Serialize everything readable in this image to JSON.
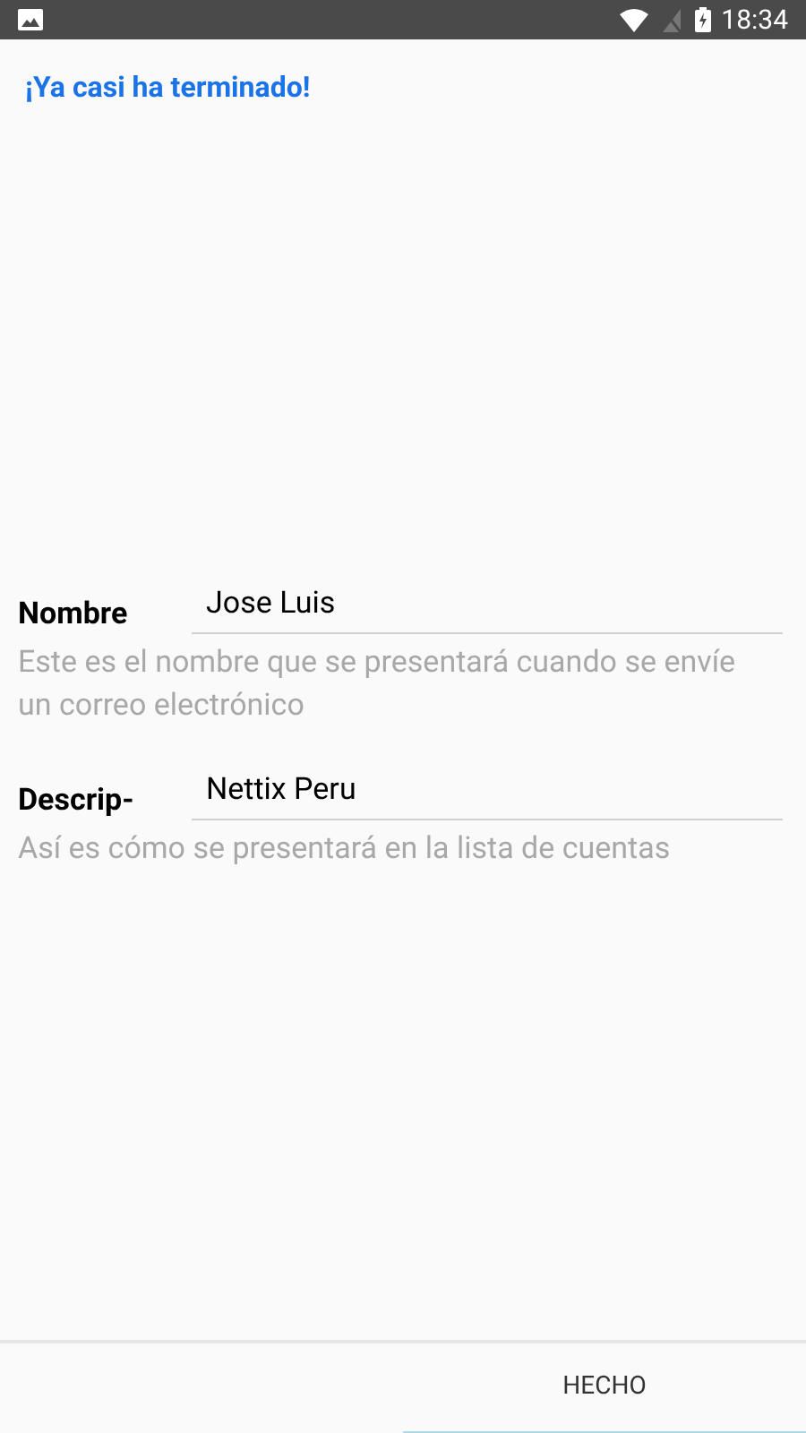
{
  "status_bar": {
    "time": "18:34"
  },
  "title": "¡Ya casi ha terminado!",
  "fields": [
    {
      "label": "Nombre",
      "value": "Jose Luis",
      "help": "Este es el nombre que se presentará cuando se envíe un correo electrónico"
    },
    {
      "label": "Descrip-",
      "value": "Nettix Peru",
      "help": "Así es cómo se presentará en la lista de cuentas"
    }
  ],
  "buttons": [
    "HECHO"
  ]
}
